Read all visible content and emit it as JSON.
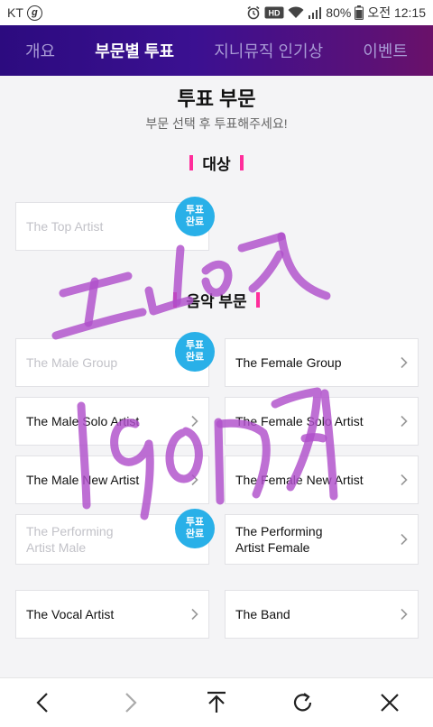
{
  "status": {
    "carrier": "KT",
    "carrier_badge": "g",
    "hd_label": "HD",
    "battery": "80%",
    "time": "오전 12:15"
  },
  "nav": {
    "tabs": [
      {
        "label": "개요",
        "active": false
      },
      {
        "label": "부문별 투표",
        "active": true
      },
      {
        "label": "지니뮤직 인기상",
        "active": false
      },
      {
        "label": "이벤트",
        "active": false
      }
    ]
  },
  "page": {
    "title": "투표 부문",
    "subtitle": "부문 선택 후 투표해주세요!"
  },
  "sections": {
    "grand": {
      "title": "대상"
    },
    "music": {
      "title": "음악 부문"
    }
  },
  "badge_text": "투표\n완료",
  "cards": {
    "top_artist": {
      "label": "The Top Artist",
      "voted": true
    },
    "male_group": {
      "label": "The Male Group",
      "voted": true
    },
    "female_group": {
      "label": "The Female Group",
      "voted": false
    },
    "male_solo": {
      "label": "The Male Solo Artist",
      "voted": false
    },
    "female_solo": {
      "label": "The Female Solo Artist",
      "voted": false
    },
    "male_new": {
      "label": "The Male New Artist",
      "voted": false
    },
    "female_new": {
      "label": "The Female New Artist",
      "voted": false
    },
    "perf_male": {
      "label": "The Performing\nArtist Male",
      "voted": true
    },
    "perf_female": {
      "label": "The Performing\nArtist Female",
      "voted": false
    },
    "vocal": {
      "label": "The Vocal Artist",
      "voted": false
    },
    "band": {
      "label": "The Band",
      "voted": false
    }
  },
  "colors": {
    "accent_pink": "#ff2d9b",
    "badge_blue": "#29b0e8",
    "nav_gradient_start": "#2c0b7f",
    "nav_gradient_end": "#6a1169",
    "handwriting_purple": "#b04fcb"
  },
  "icons": {
    "back": "chevron-left-icon",
    "forward": "chevron-right-icon",
    "top": "arrow-up-to-top-icon",
    "refresh": "refresh-icon",
    "close": "close-icon"
  }
}
